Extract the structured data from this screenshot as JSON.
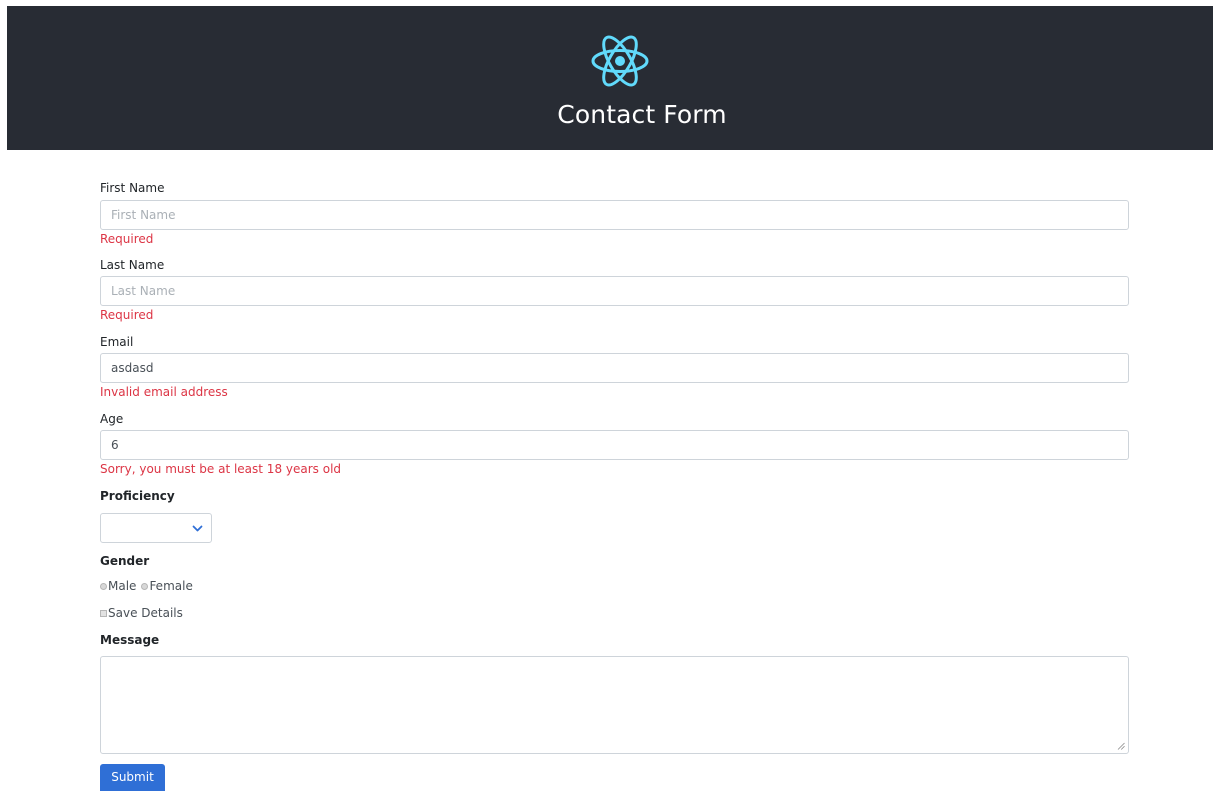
{
  "colors": {
    "header_bg": "#282c34",
    "logo": "#61dafb",
    "error": "#dc3545",
    "primary": "#2f6fd6",
    "border": "#ced4da"
  },
  "header": {
    "logo_icon": "react-atom-icon",
    "title": "Contact Form"
  },
  "form": {
    "first_name": {
      "label": "First Name",
      "placeholder": "First Name",
      "value": "",
      "error": "Required"
    },
    "last_name": {
      "label": "Last Name",
      "placeholder": "Last Name",
      "value": "",
      "error": "Required"
    },
    "email": {
      "label": "Email",
      "placeholder": "",
      "value": "asdasd",
      "error": "Invalid email address"
    },
    "age": {
      "label": "Age",
      "placeholder": "",
      "value": "6",
      "error": "Sorry, you must be at least 18 years old"
    },
    "proficiency": {
      "label": "Proficiency",
      "selected": "",
      "icon": "chevron-down-icon"
    },
    "gender": {
      "label": "Gender",
      "options": [
        "Male",
        "Female"
      ]
    },
    "save_details": {
      "label": "Save Details",
      "checked": false
    },
    "message": {
      "label": "Message",
      "value": ""
    },
    "submit_label": "Submit"
  }
}
